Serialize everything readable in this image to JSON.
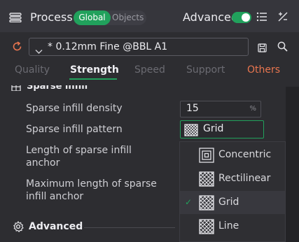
{
  "header": {
    "title": "Process",
    "scope_tabs": [
      "Global",
      "Objects"
    ],
    "advanced_label": "Advanced",
    "advanced_enabled": true,
    "icons": [
      "process-icon",
      "list-icon",
      "compare-icon"
    ]
  },
  "preset": {
    "value": "* 0.12mm Fine @BBL A1",
    "icons": [
      "reset-icon",
      "chevron-down-icon",
      "save-icon",
      "search-icon"
    ]
  },
  "tabs": [
    {
      "label": "Quality",
      "active": false
    },
    {
      "label": "Strength",
      "active": true
    },
    {
      "label": "Speed",
      "active": false
    },
    {
      "label": "Support",
      "active": false
    },
    {
      "label": "Others",
      "active": false
    }
  ],
  "section": {
    "title": "Sparse infill"
  },
  "settings": {
    "density_label": "Sparse infill density",
    "density_value": "15",
    "density_unit": "%",
    "pattern_label": "Sparse infill pattern",
    "pattern_value": "Grid",
    "anchor_label_line1": "Length of sparse infill",
    "anchor_label_line2": "anchor",
    "max_anchor_label_line1": "Maximum length of sparse",
    "max_anchor_label_line2": "infill anchor"
  },
  "dropdown": {
    "options": [
      "Concentric",
      "Rectilinear",
      "Grid",
      "Line"
    ],
    "selected": "Grid",
    "check_glyph": "✓"
  },
  "advanced_section": {
    "title": "Advanced"
  },
  "colors": {
    "accent": "#21a15c",
    "others_tab": "#e8754f",
    "background": "#2d2d31",
    "header": "#36363c"
  }
}
